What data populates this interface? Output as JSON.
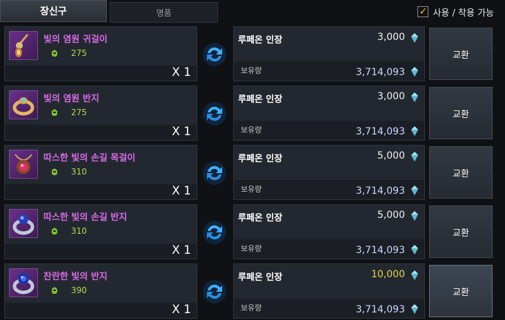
{
  "tabs": [
    {
      "label": "장신구",
      "active": true
    },
    {
      "label": "명품",
      "active": false
    }
  ],
  "usable_filter": {
    "label": "사용 / 착용 가능",
    "checked": true
  },
  "rows": [
    {
      "name": "빛의 염원 귀걸이",
      "level": "275",
      "qty": "X 1",
      "icon": "earring-icon",
      "cost_name": "루페온 인장",
      "cost": "3,000",
      "held_label": "보유량",
      "held": "3,714,093",
      "button": "교환"
    },
    {
      "name": "빛의 염원 반지",
      "level": "275",
      "qty": "X 1",
      "icon": "ring-icon",
      "cost_name": "루페온 인장",
      "cost": "3,000",
      "held_label": "보유량",
      "held": "3,714,093",
      "button": "교환"
    },
    {
      "name": "따스한 빛의 손길 목걸이",
      "level": "310",
      "qty": "X 1",
      "icon": "necklace-icon",
      "cost_name": "루페온 인장",
      "cost": "5,000",
      "held_label": "보유량",
      "held": "3,714,093",
      "button": "교환"
    },
    {
      "name": "따스한 빛의 손길 반지",
      "level": "310",
      "qty": "X 1",
      "icon": "ring-icon",
      "cost_name": "루페온 인장",
      "cost": "5,000",
      "held_label": "보유량",
      "held": "3,714,093",
      "button": "교환"
    },
    {
      "name": "찬란한 빛의 반지",
      "level": "390",
      "qty": "X 1",
      "icon": "ring-icon",
      "cost_name": "루페온 인장",
      "cost": "10,000",
      "held_label": "보유량",
      "held": "3,714,093",
      "button": "교환"
    }
  ],
  "colors": {
    "item_name": "#d96ae8",
    "level": "#b6d84a",
    "cost_highlight": "#e6d84a",
    "held": "#cfd6ff",
    "swap_icon": "#3fb0ff"
  }
}
